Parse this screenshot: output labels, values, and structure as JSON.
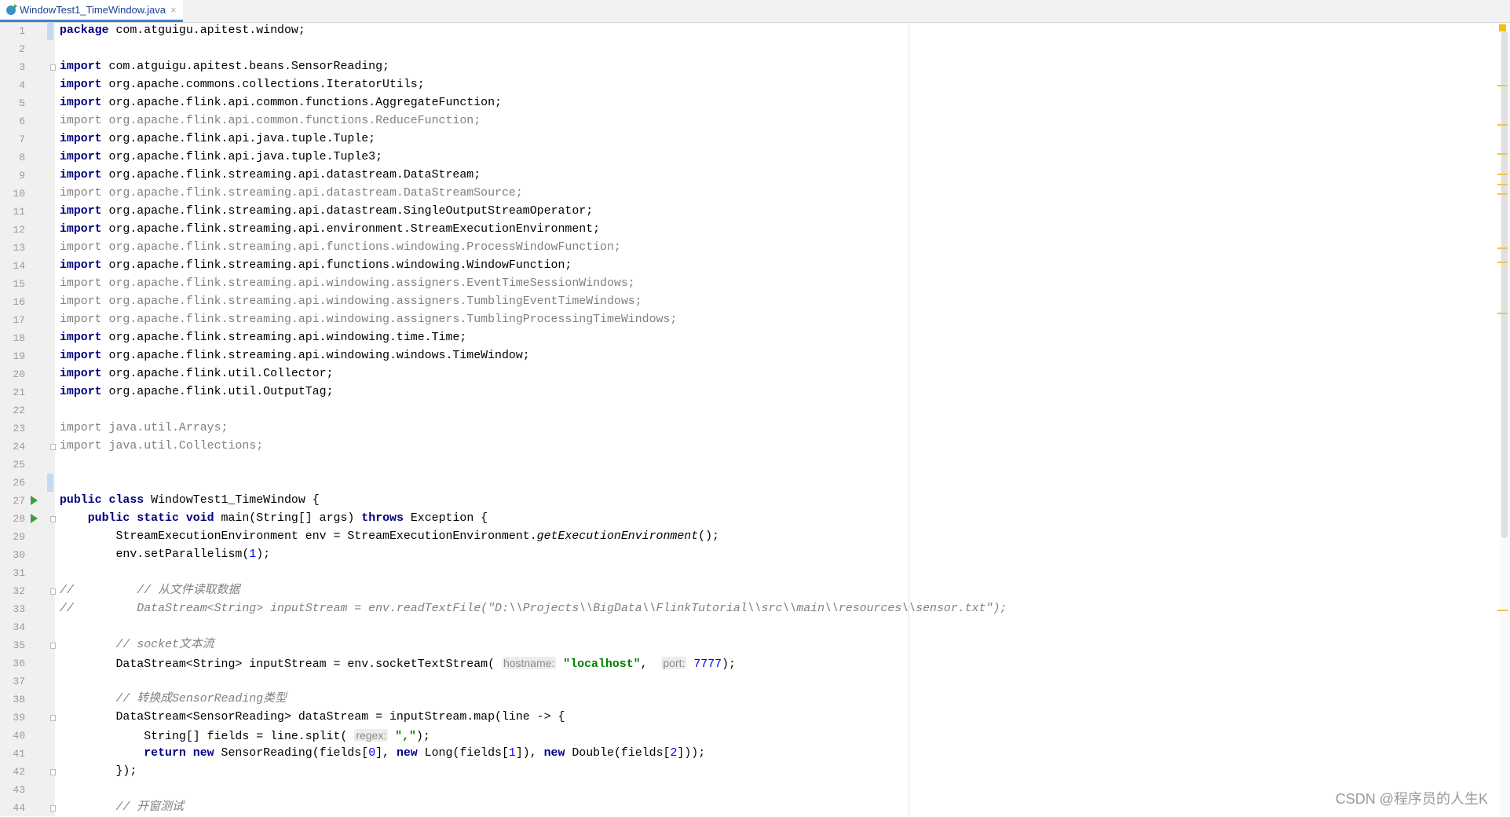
{
  "tab": {
    "filename": "WindowTest1_TimeWindow.java",
    "close": "×"
  },
  "watermark": "CSDN @程序员的人生K",
  "lines": [
    [
      [
        "kw",
        "package"
      ],
      [
        "p",
        " com.atguigu.apitest.window;"
      ]
    ],
    [],
    [
      [
        "kw",
        "import"
      ],
      [
        "p",
        " com.atguigu.apitest.beans.SensorReading;"
      ]
    ],
    [
      [
        "kw",
        "import"
      ],
      [
        "p",
        " org.apache.commons.collections.IteratorUtils;"
      ]
    ],
    [
      [
        "kw",
        "import"
      ],
      [
        "p",
        " org.apache.flink.api.common.functions.AggregateFunction;"
      ]
    ],
    [
      [
        "gray",
        "import org.apache.flink.api.common.functions.ReduceFunction;"
      ]
    ],
    [
      [
        "kw",
        "import"
      ],
      [
        "p",
        " org.apache.flink.api.java.tuple.Tuple;"
      ]
    ],
    [
      [
        "kw",
        "import"
      ],
      [
        "p",
        " org.apache.flink.api.java.tuple.Tuple3;"
      ]
    ],
    [
      [
        "kw",
        "import"
      ],
      [
        "p",
        " org.apache.flink.streaming.api.datastream.DataStream;"
      ]
    ],
    [
      [
        "gray",
        "import org.apache.flink.streaming.api.datastream.DataStreamSource;"
      ]
    ],
    [
      [
        "kw",
        "import"
      ],
      [
        "p",
        " org.apache.flink.streaming.api.datastream.SingleOutputStreamOperator;"
      ]
    ],
    [
      [
        "kw",
        "import"
      ],
      [
        "p",
        " org.apache.flink.streaming.api.environment.StreamExecutionEnvironment;"
      ]
    ],
    [
      [
        "gray",
        "import org.apache.flink.streaming.api.functions.windowing.ProcessWindowFunction;"
      ]
    ],
    [
      [
        "kw",
        "import"
      ],
      [
        "p",
        " org.apache.flink.streaming.api.functions.windowing.WindowFunction;"
      ]
    ],
    [
      [
        "gray",
        "import org.apache.flink.streaming.api.windowing.assigners.EventTimeSessionWindows;"
      ]
    ],
    [
      [
        "gray",
        "import org.apache.flink.streaming.api.windowing.assigners.TumblingEventTimeWindows;"
      ]
    ],
    [
      [
        "gray",
        "import org.apache.flink.streaming.api.windowing.assigners.TumblingProcessingTimeWindows;"
      ]
    ],
    [
      [
        "kw",
        "import"
      ],
      [
        "p",
        " org.apache.flink.streaming.api.windowing.time.Time;"
      ]
    ],
    [
      [
        "kw",
        "import"
      ],
      [
        "p",
        " org.apache.flink.streaming.api.windowing.windows.TimeWindow;"
      ]
    ],
    [
      [
        "kw",
        "import"
      ],
      [
        "p",
        " org.apache.flink.util.Collector;"
      ]
    ],
    [
      [
        "kw",
        "import"
      ],
      [
        "p",
        " org.apache.flink.util.OutputTag;"
      ]
    ],
    [],
    [
      [
        "gray",
        "import java.util.Arrays;"
      ]
    ],
    [
      [
        "gray",
        "import java.util.Collections;"
      ]
    ],
    [],
    [],
    [
      [
        "kw",
        "public class"
      ],
      [
        "p",
        " WindowTest1_TimeWindow {"
      ]
    ],
    [
      [
        "p",
        "    "
      ],
      [
        "kw",
        "public static void"
      ],
      [
        "p",
        " main(String[] args) "
      ],
      [
        "kw",
        "throws"
      ],
      [
        "p",
        " Exception {"
      ]
    ],
    [
      [
        "p",
        "        StreamExecutionEnvironment env = StreamExecutionEnvironment."
      ],
      [
        "it",
        "getExecutionEnvironment"
      ],
      [
        "p",
        "();"
      ]
    ],
    [
      [
        "p",
        "        env.setParallelism("
      ],
      [
        "num",
        "1"
      ],
      [
        "p",
        ");"
      ]
    ],
    [],
    [
      [
        "cmt",
        "//         // 从文件读取数据"
      ]
    ],
    [
      [
        "cmt",
        "//         DataStream<String> inputStream = env.readTextFile(\"D:\\\\Projects\\\\BigData\\\\FlinkTutorial\\\\src\\\\main\\\\resources\\\\sensor.txt\");"
      ]
    ],
    [],
    [
      [
        "cmt",
        "        // socket文本流"
      ]
    ],
    [
      [
        "p",
        "        DataStream<String> inputStream = env.socketTextStream( "
      ],
      [
        "hint",
        "hostname:"
      ],
      [
        "p",
        " "
      ],
      [
        "str",
        "\"localhost\""
      ],
      [
        "p",
        ",  "
      ],
      [
        "hint",
        "port:"
      ],
      [
        "p",
        " "
      ],
      [
        "num",
        "7777"
      ],
      [
        "p",
        ");"
      ]
    ],
    [],
    [
      [
        "cmt",
        "        // 转换成SensorReading类型"
      ]
    ],
    [
      [
        "p",
        "        DataStream<SensorReading> dataStream = inputStream.map(line -> {"
      ]
    ],
    [
      [
        "p",
        "            String[] fields = line.split( "
      ],
      [
        "hint",
        "regex:"
      ],
      [
        "p",
        " "
      ],
      [
        "str",
        "\",\""
      ],
      [
        "p",
        ");"
      ]
    ],
    [
      [
        "p",
        "            "
      ],
      [
        "kw",
        "return new"
      ],
      [
        "p",
        " SensorReading(fields["
      ],
      [
        "num",
        "0"
      ],
      [
        "p",
        "], "
      ],
      [
        "kw",
        "new"
      ],
      [
        "p",
        " Long(fields["
      ],
      [
        "num",
        "1"
      ],
      [
        "p",
        "]), "
      ],
      [
        "kw",
        "new"
      ],
      [
        "p",
        " Double(fields["
      ],
      [
        "num",
        "2"
      ],
      [
        "p",
        "]));"
      ]
    ],
    [
      [
        "p",
        "        });"
      ]
    ],
    [],
    [
      [
        "cmt",
        "        // 开窗测试"
      ]
    ]
  ],
  "run_lines": [
    27,
    28
  ],
  "fold_lines": [
    3,
    24,
    28,
    32,
    35,
    39,
    42,
    44
  ],
  "caret_lines": [
    1,
    26
  ]
}
